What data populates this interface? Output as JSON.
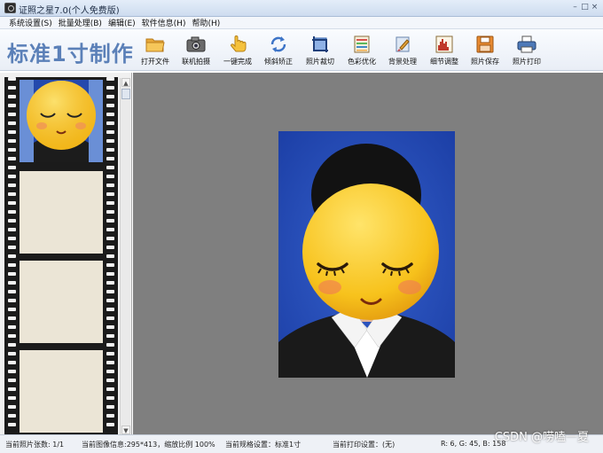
{
  "window": {
    "title": "证照之星7.0(个人免费版)",
    "controls": [
      "–",
      "□",
      "×"
    ]
  },
  "menu": [
    "系统设置(S)",
    "批量处理(B)",
    "编辑(E)",
    "软件信息(H)",
    "帮助(H)"
  ],
  "toolbar": {
    "app_label": "标准1寸制作",
    "buttons": [
      {
        "label": "打开文件",
        "icon": "folder-icon"
      },
      {
        "label": "联机拍摄",
        "icon": "camera-icon"
      },
      {
        "label": "一键完成",
        "icon": "hand-click-icon"
      },
      {
        "label": "倾斜矫正",
        "icon": "rotate-icon"
      },
      {
        "label": "照片裁切",
        "icon": "crop-icon"
      },
      {
        "label": "色彩优化",
        "icon": "palette-icon"
      },
      {
        "label": "背景处理",
        "icon": "brush-icon"
      },
      {
        "label": "细节调整",
        "icon": "histogram-icon"
      },
      {
        "label": "照片保存",
        "icon": "save-icon"
      },
      {
        "label": "照片打印",
        "icon": "printer-icon"
      }
    ]
  },
  "status": {
    "photo_count": "当前照片张数: 1/1",
    "image_info": "当前图像信息:295*413，缩放比例 100%",
    "spec": "当前规格设置：标准1寸",
    "print": "当前打印设置：(无)",
    "rgb": "R: 6, G: 45, B: 158"
  },
  "watermark": "CSDN @唠嗑一夏",
  "colors": {
    "photo_background": "#2549b5",
    "canvas": "#7f7f7f",
    "app_label": "#5b80b8"
  }
}
